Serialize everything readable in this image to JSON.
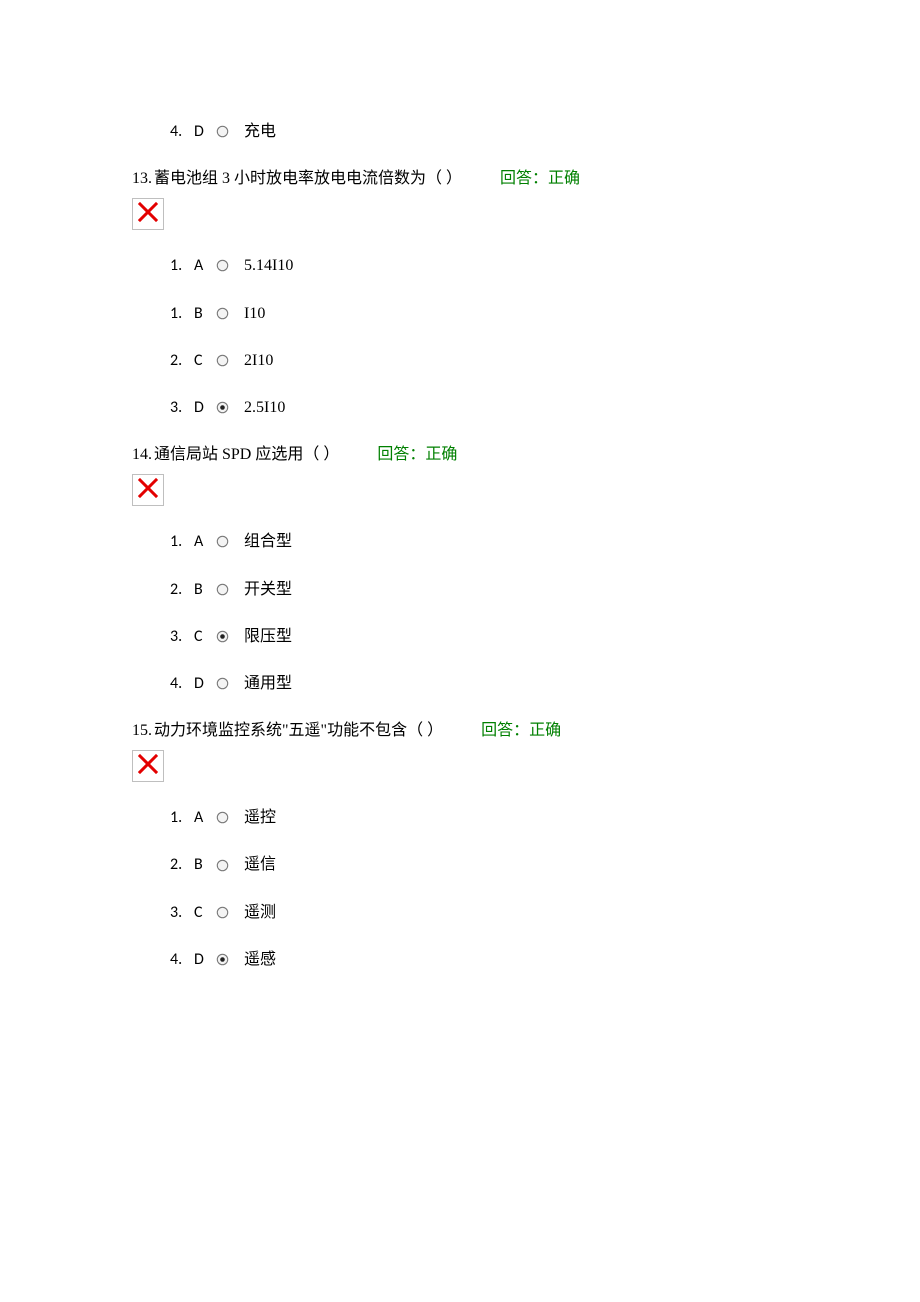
{
  "orphan_option": {
    "num": "4.",
    "letter": "D",
    "selected": false,
    "text": "充电"
  },
  "questions": [
    {
      "number": "13.",
      "text": "蓄电池组 3 小时放电率放电电流倍数为（ ）",
      "feedback_label": "回答：",
      "feedback_value": "正确",
      "options": [
        {
          "num": "1.",
          "letter": "A",
          "selected": false,
          "text": "5.14I10"
        },
        {
          "num": "1.",
          "letter": "B",
          "selected": false,
          "text": "I10"
        },
        {
          "num": "2.",
          "letter": "C",
          "selected": false,
          "text": "2I10"
        },
        {
          "num": "3.",
          "letter": "D",
          "selected": true,
          "text": "2.5I10"
        }
      ]
    },
    {
      "number": "14.",
      "text": "通信局站 SPD 应选用（ ）",
      "feedback_label": "回答：",
      "feedback_value": "正确",
      "options": [
        {
          "num": "1.",
          "letter": "A",
          "selected": false,
          "text": "组合型"
        },
        {
          "num": "2.",
          "letter": "B",
          "selected": false,
          "text": "开关型"
        },
        {
          "num": "3.",
          "letter": "C",
          "selected": true,
          "text": "限压型"
        },
        {
          "num": "4.",
          "letter": "D",
          "selected": false,
          "text": "通用型"
        }
      ]
    },
    {
      "number": "15.",
      "text": "动力环境监控系统\"五遥\"功能不包含（ ）",
      "feedback_label": "回答：",
      "feedback_value": "正确",
      "options": [
        {
          "num": "1.",
          "letter": "A",
          "selected": false,
          "text": "遥控"
        },
        {
          "num": "2.",
          "letter": "B",
          "selected": false,
          "text": "遥信"
        },
        {
          "num": "3.",
          "letter": "C",
          "selected": false,
          "text": "遥测"
        },
        {
          "num": "4.",
          "letter": "D",
          "selected": true,
          "text": "遥感"
        }
      ]
    }
  ]
}
